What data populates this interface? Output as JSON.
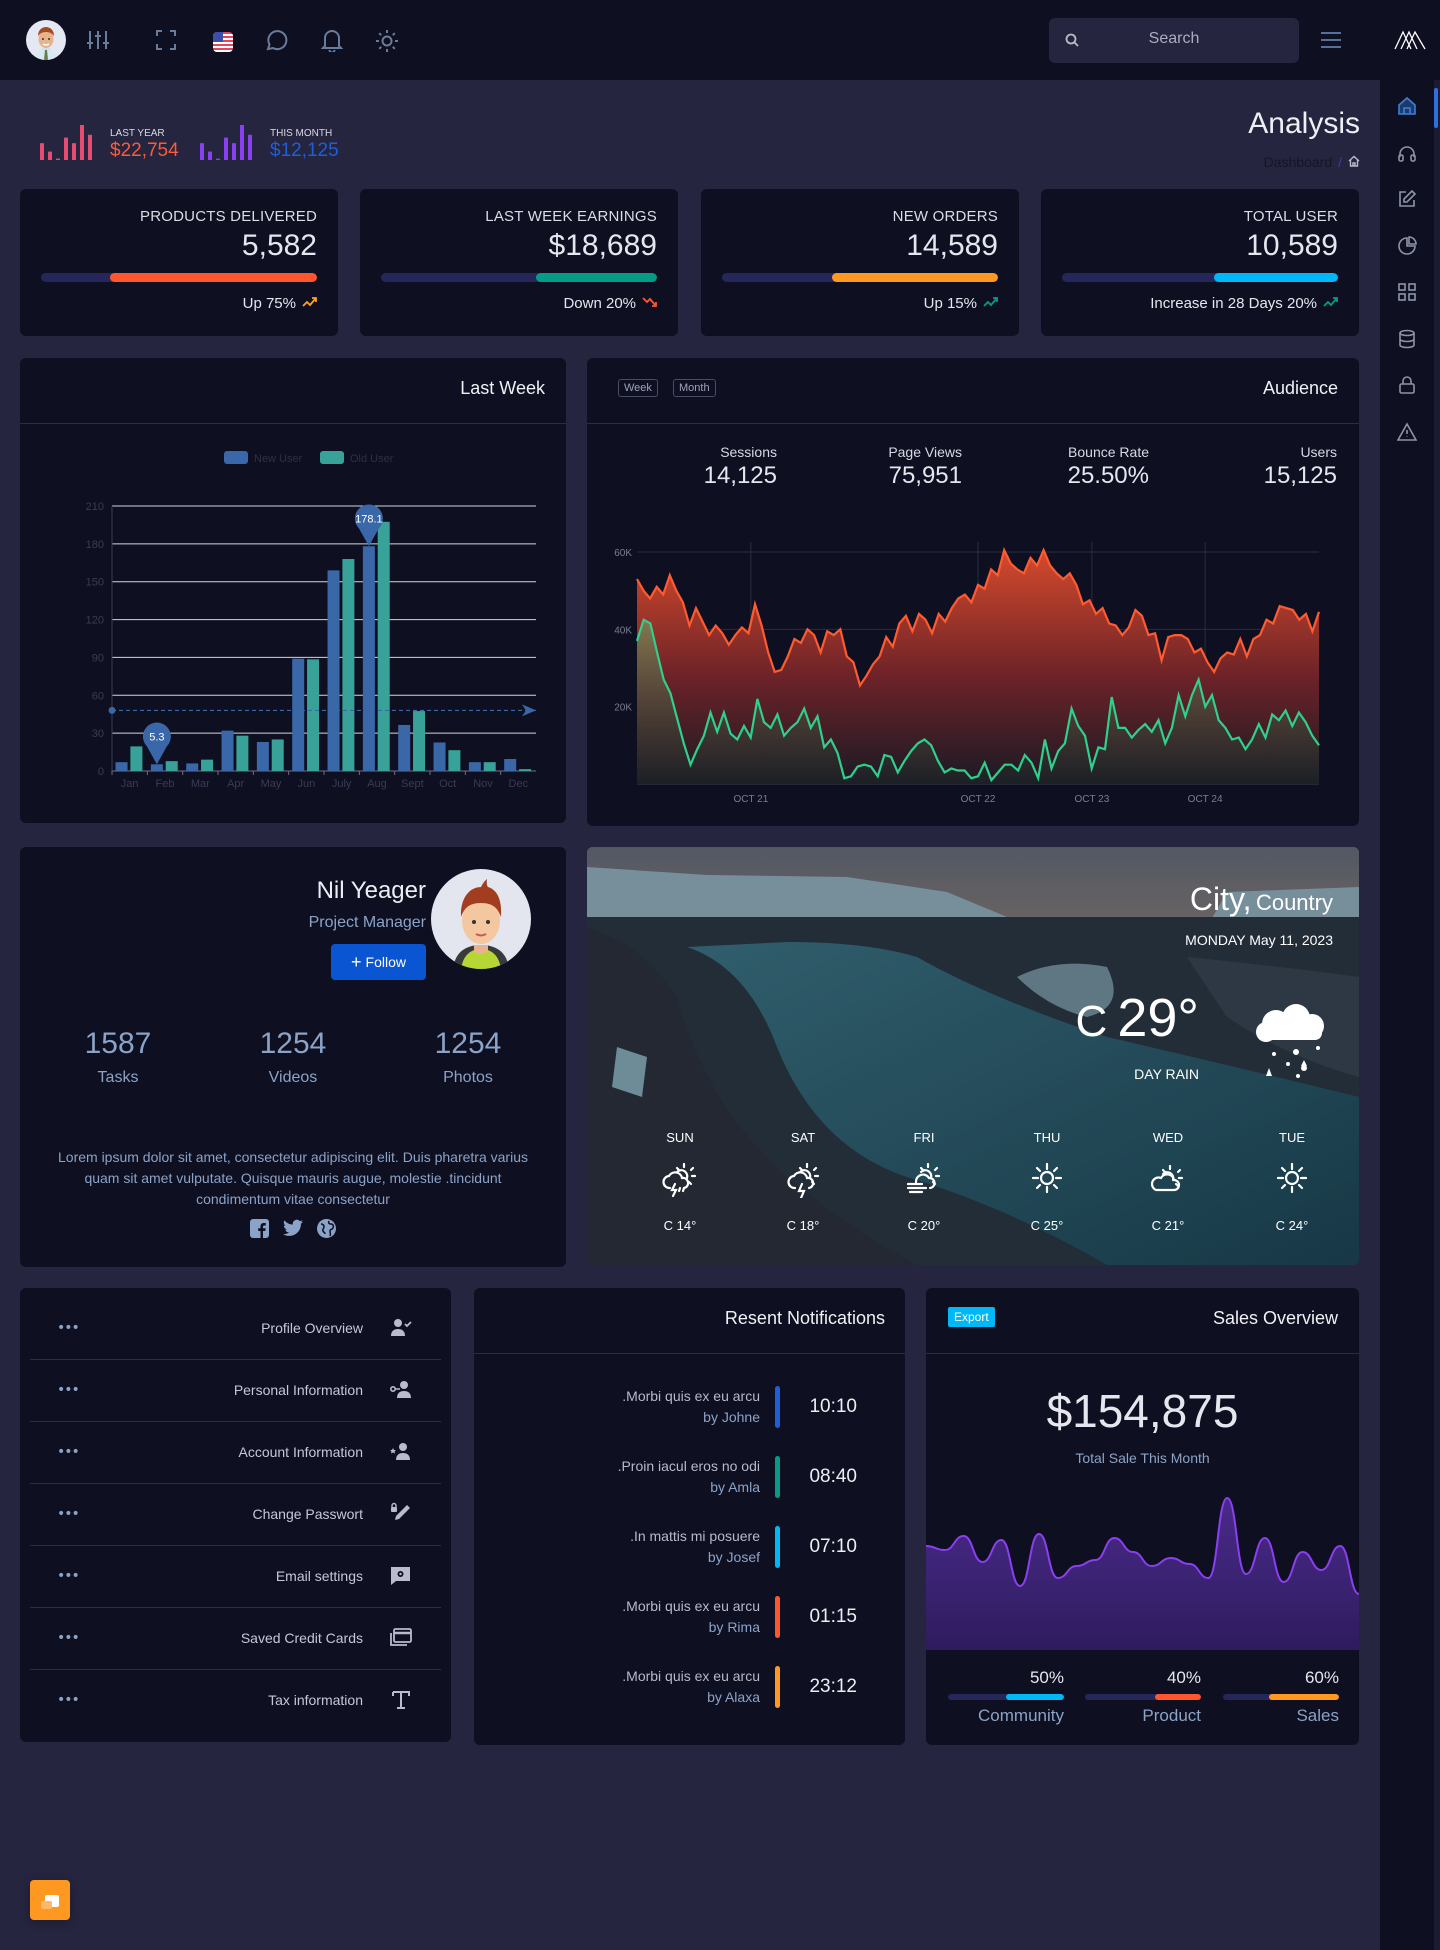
{
  "topbar": {
    "search_placeholder": "Search",
    "icons": [
      "user-avatar",
      "sliders-icon",
      "fullscreen-icon",
      "us-flag-icon",
      "chat-icon",
      "bell-icon",
      "sun-icon",
      "search-icon",
      "hamburger-menu-icon",
      "brand-logo"
    ]
  },
  "mini_stats": [
    {
      "label": "LAST YEAR",
      "value": "$22,754",
      "color": "#e84b72",
      "value_color": "#ff5a36"
    },
    {
      "label": "THIS MONTH",
      "value": "$12,125",
      "color": "#8a3ff0",
      "value_color": "#1e5fd8"
    }
  ],
  "page": {
    "title": "Analysis",
    "breadcrumb": "Dashboard",
    "breadcrumb_sep": "/"
  },
  "sidebar": {
    "items": [
      "home",
      "headphones",
      "edit",
      "pie-chart",
      "grid",
      "database",
      "lock",
      "warning"
    ]
  },
  "stat_cards": [
    {
      "label": "PRODUCTS DELIVERED",
      "value": "5,582",
      "progress": 75,
      "color": "#ff5630",
      "footer": "Up 75%",
      "trend": "up",
      "trend_color": "#ff9f1c"
    },
    {
      "label": "LAST WEEK EARNINGS",
      "value": "$18,689",
      "progress": 44,
      "color": "#069b87",
      "footer": "Down 20%",
      "trend": "down",
      "trend_color": "#ff5630"
    },
    {
      "label": "NEW ORDERS",
      "value": "14,589",
      "progress": 60,
      "color": "#ff9820",
      "footer": "Up 15%",
      "trend": "up",
      "trend_color": "#069b87"
    },
    {
      "label": "TOTAL USER",
      "value": "10,589",
      "progress": 45,
      "color": "#00b8f5",
      "footer": "Increase in 28 Days 20%",
      "trend": "up",
      "trend_color": "#069b87"
    }
  ],
  "last_week": {
    "title": "Last Week"
  },
  "audience": {
    "title": "Audience",
    "buttons": [
      "Week",
      "Month"
    ],
    "metrics": [
      {
        "label": "Sessions",
        "value": "14,125"
      },
      {
        "label": "Page Views",
        "value": "75,951"
      },
      {
        "label": "Bounce Rate",
        "value": "25.50%"
      },
      {
        "label": "Users",
        "value": "15,125"
      }
    ]
  },
  "chart_data": [
    {
      "type": "bar",
      "title": "Last Week",
      "categories": [
        "Jan",
        "Feb",
        "Mar",
        "Apr",
        "May",
        "Jun",
        "July",
        "Aug",
        "Sept",
        "Oct",
        "Nov",
        "Dec"
      ],
      "series": [
        {
          "name": "New User",
          "color": "#3a67a8",
          "values": [
            7,
            5.3,
            6,
            32,
            23,
            89,
            159,
            178.1,
            36.5,
            22.6,
            7,
            9.5
          ]
        },
        {
          "name": "Old User",
          "color": "#38a198",
          "values": [
            19.5,
            7.8,
            9,
            28,
            25,
            88.5,
            168,
            197.5,
            47.5,
            16.5,
            7,
            1.5
          ]
        }
      ],
      "yticks": [
        0,
        30,
        60,
        90,
        120,
        150,
        180,
        210
      ],
      "ylim": [
        0,
        210
      ],
      "markers": [
        {
          "label": "5.3",
          "category": "Feb",
          "series": "New User"
        },
        {
          "label": "178.1",
          "category": "Aug",
          "series": "New User"
        }
      ],
      "average_line": 48,
      "legend": "top-center",
      "grid": true
    },
    {
      "type": "area",
      "title": "Audience",
      "xticks": [
        "OCT 21",
        "OCT 22",
        "OCT 23",
        "OCT 24"
      ],
      "yticks": [
        "20K",
        "40K",
        "60K"
      ],
      "ylim": [
        0,
        60000
      ],
      "series": [
        {
          "name": "Page Views",
          "color": "#ff5a30",
          "values": [
            53000,
            50000,
            48000,
            51000,
            49000,
            54000,
            50000,
            47000,
            41000,
            45500,
            42000,
            38500,
            41000,
            39000,
            36000,
            38500,
            40500,
            39000,
            46500,
            41000,
            34000,
            29000,
            29500,
            33000,
            37500,
            36500,
            40000,
            38500,
            34000,
            39500,
            38500,
            40000,
            33000,
            31500,
            25500,
            28000,
            31000,
            33000,
            38000,
            35500,
            41500,
            43500,
            39500,
            44000,
            42500,
            39000,
            44000,
            42000,
            45500,
            48000,
            49000,
            47000,
            51500,
            50500,
            55500,
            54000,
            60500,
            57000,
            55500,
            54500,
            58500,
            56500,
            60500,
            56500,
            54500,
            53000,
            54500,
            51500,
            46500,
            47500,
            44000,
            45500,
            41500,
            41000,
            38500,
            40500,
            45000,
            43500,
            38500,
            39000,
            32000,
            38000,
            38500,
            38500,
            37500,
            34000,
            35000,
            31500,
            29000,
            32500,
            34000,
            33500,
            37500,
            33000,
            37500,
            38500,
            42500,
            41500,
            46000,
            45500,
            45000,
            42500,
            44000,
            39500,
            44500
          ]
        },
        {
          "name": "Sessions",
          "color": "#2fd08c",
          "values": [
            37000,
            42500,
            41500,
            34000,
            27000,
            23500,
            17000,
            10500,
            5000,
            9000,
            12500,
            18500,
            13500,
            18500,
            13000,
            11500,
            15000,
            12000,
            22000,
            16000,
            14500,
            18000,
            12500,
            14500,
            16000,
            19500,
            14500,
            17500,
            9500,
            11500,
            8000,
            1500,
            2000,
            4500,
            5000,
            4500,
            2000,
            7500,
            7000,
            3000,
            6000,
            8500,
            10500,
            11500,
            10000,
            6000,
            3000,
            4000,
            3500,
            3500,
            1500,
            2000,
            5500,
            1000,
            3000,
            5000,
            5000,
            3500,
            7500,
            5500,
            1500,
            11500,
            4000,
            8500,
            10500,
            19500,
            15000,
            12500,
            4000,
            9500,
            9000,
            22500,
            14500,
            14500,
            12000,
            14000,
            15500,
            13500,
            16500,
            10500,
            14500,
            23000,
            17500,
            23000,
            27000,
            20000,
            23000,
            16500,
            14500,
            11500,
            12000,
            9000,
            11500,
            15500,
            12000,
            18000,
            16500,
            19000,
            15000,
            18500,
            16000,
            12500,
            10000
          ]
        }
      ],
      "grid": true
    },
    {
      "type": "area",
      "title": "Sales Overview",
      "series": [
        {
          "name": "Sales",
          "color": "#8a3ff0",
          "values": [
            52,
            50,
            57,
            44,
            55,
            32,
            58,
            36,
            42,
            45,
            56,
            49,
            42,
            46,
            43,
            36,
            76,
            38,
            56,
            34,
            49,
            40,
            52,
            28
          ]
        }
      ]
    }
  ],
  "profile": {
    "name": "Nil Yeager",
    "role": "Project Manager",
    "follow_label": "Follow",
    "stats": [
      {
        "value": "1587",
        "label": "Tasks"
      },
      {
        "value": "1254",
        "label": "Videos"
      },
      {
        "value": "1254",
        "label": "Photos"
      }
    ],
    "bio": "Lorem ipsum dolor sit amet, consectetur adipiscing elit. Duis pharetra varius quam sit amet vulputate. Quisque mauris augue, molestie .tincidunt condimentum vitae consectetur",
    "socials": [
      "facebook",
      "twitter",
      "globe"
    ]
  },
  "weather": {
    "city": "City,",
    "country": "Country",
    "date": "MONDAY May 11, 2023",
    "unit": "C",
    "temp": "29°",
    "condition": "DAY RAIN",
    "forecast": [
      {
        "day": "SUN",
        "temp": "C 14°",
        "icon": "thunder-rain-sun"
      },
      {
        "day": "SAT",
        "temp": "C 18°",
        "icon": "thunder-sun"
      },
      {
        "day": "FRI",
        "temp": "C 20°",
        "icon": "windy-cloud-sun"
      },
      {
        "day": "THU",
        "temp": "C 25°",
        "icon": "sun"
      },
      {
        "day": "WED",
        "temp": "C 21°",
        "icon": "cloud-sun"
      },
      {
        "day": "TUE",
        "temp": "C 24°",
        "icon": "sun"
      }
    ]
  },
  "profile_menu": [
    {
      "label": "Profile Overview",
      "icon": "user-check"
    },
    {
      "label": "Personal Information",
      "icon": "user-key"
    },
    {
      "label": "Account Information",
      "icon": "user-star"
    },
    {
      "label": "Change Passwort",
      "icon": "pencil-lock"
    },
    {
      "label": "Email settings",
      "icon": "message-gear"
    },
    {
      "label": "Saved Credit Cards",
      "icon": "cards"
    },
    {
      "label": "Tax information",
      "icon": "text-t"
    }
  ],
  "notifications": {
    "title": "Resent Notifications",
    "items": [
      {
        "text": ".Morbi quis ex eu arcu",
        "by": "by Johne",
        "time": "10:10",
        "color": "#1e5fd8"
      },
      {
        "text": ".Proin iacul eros no odi",
        "by": "by Amla",
        "time": "08:40",
        "color": "#069b87"
      },
      {
        "text": ".In mattis mi posuere",
        "by": "by Josef",
        "time": "07:10",
        "color": "#00b8f5"
      },
      {
        "text": ".Morbi quis ex eu arcu",
        "by": "by Rima",
        "time": "01:15",
        "color": "#ff5630"
      },
      {
        "text": ".Morbi quis ex eu arcu",
        "by": "by Alaxa",
        "time": "23:12",
        "color": "#ff9820"
      }
    ]
  },
  "sales": {
    "title": "Sales Overview",
    "export_label": "Export",
    "total": "$154,875",
    "subtitle": "Total Sale This Month",
    "bars": [
      {
        "label": "Community",
        "percent": "50%",
        "value": 50,
        "color": "#00b8f5"
      },
      {
        "label": "Product",
        "percent": "40%",
        "value": 40,
        "color": "#ff5630"
      },
      {
        "label": "Sales",
        "percent": "60%",
        "value": 60,
        "color": "#ff9820"
      }
    ]
  },
  "floating_button": {
    "icon": "chat-bubbles-icon",
    "color": "#ff9820"
  }
}
